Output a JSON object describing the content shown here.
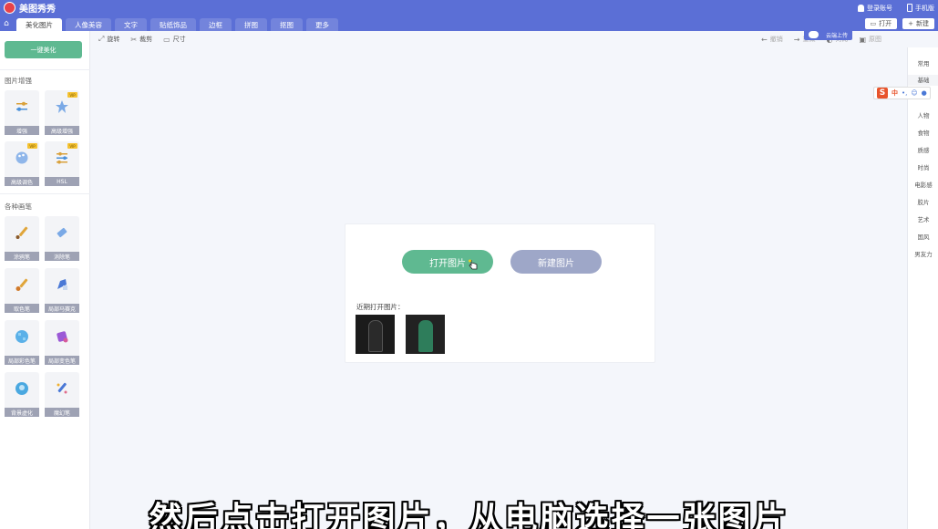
{
  "app": {
    "title": "美图秀秀"
  },
  "top_right": {
    "login": "登录账号",
    "phone": "手机版"
  },
  "tabs": [
    {
      "label": "美化图片"
    },
    {
      "label": "人像美容"
    },
    {
      "label": "文字"
    },
    {
      "label": "贴纸饰品"
    },
    {
      "label": "边框"
    },
    {
      "label": "拼图"
    },
    {
      "label": "抠图"
    },
    {
      "label": "更多"
    }
  ],
  "tab_actions": {
    "open": "打开",
    "new": "新建"
  },
  "toolbar": {
    "rotate": "旋转",
    "crop": "裁剪",
    "size": "尺寸",
    "undo": "撤销",
    "redo": "重做",
    "compare": "对比",
    "original": "原图"
  },
  "cloud": {
    "label": "云端上传"
  },
  "sidebar": {
    "one_click": "一键美化",
    "section1": "图片增强",
    "tools1": [
      {
        "label": "增强",
        "icon": "sliders-icon",
        "vip": ""
      },
      {
        "label": "高级增强",
        "icon": "magic-star-icon",
        "vip": "VIP"
      },
      {
        "label": "高级调色",
        "icon": "palette-icon",
        "vip": "VIP"
      },
      {
        "label": "HSL",
        "icon": "hsl-sliders-icon",
        "vip": "VIP"
      }
    ],
    "section2": "各种画笔",
    "tools2": [
      {
        "label": "涂鸦笔",
        "icon": "brush-icon"
      },
      {
        "label": "消除笔",
        "icon": "eraser-icon"
      },
      {
        "label": "取色笔",
        "icon": "color-picker-brush-icon"
      },
      {
        "label": "局部马赛克",
        "icon": "mosaic-pen-icon"
      },
      {
        "label": "局部彩色笔",
        "icon": "color-pen-icon"
      },
      {
        "label": "局部变色笔",
        "icon": "recolor-pen-icon"
      },
      {
        "label": "背景虚化",
        "icon": "blur-background-icon"
      },
      {
        "label": "魔幻笔",
        "icon": "magic-pen-icon"
      }
    ]
  },
  "right_sidebar": [
    "常用",
    "基础",
    "人物",
    "食物",
    "质感",
    "时尚",
    "电影感",
    "胶片",
    "艺术",
    "国风",
    "男友力"
  ],
  "ime": {
    "zh": "中"
  },
  "dialog": {
    "open_button": "打开图片",
    "new_button": "新建图片",
    "recent_label": "近期打开图片："
  },
  "subtitle": "然后点击打开图片，从电脑选择一张图片",
  "colors": {
    "brand": "#5b6fd6",
    "green": "#5fb991",
    "muted_button": "#9ea7c8"
  }
}
